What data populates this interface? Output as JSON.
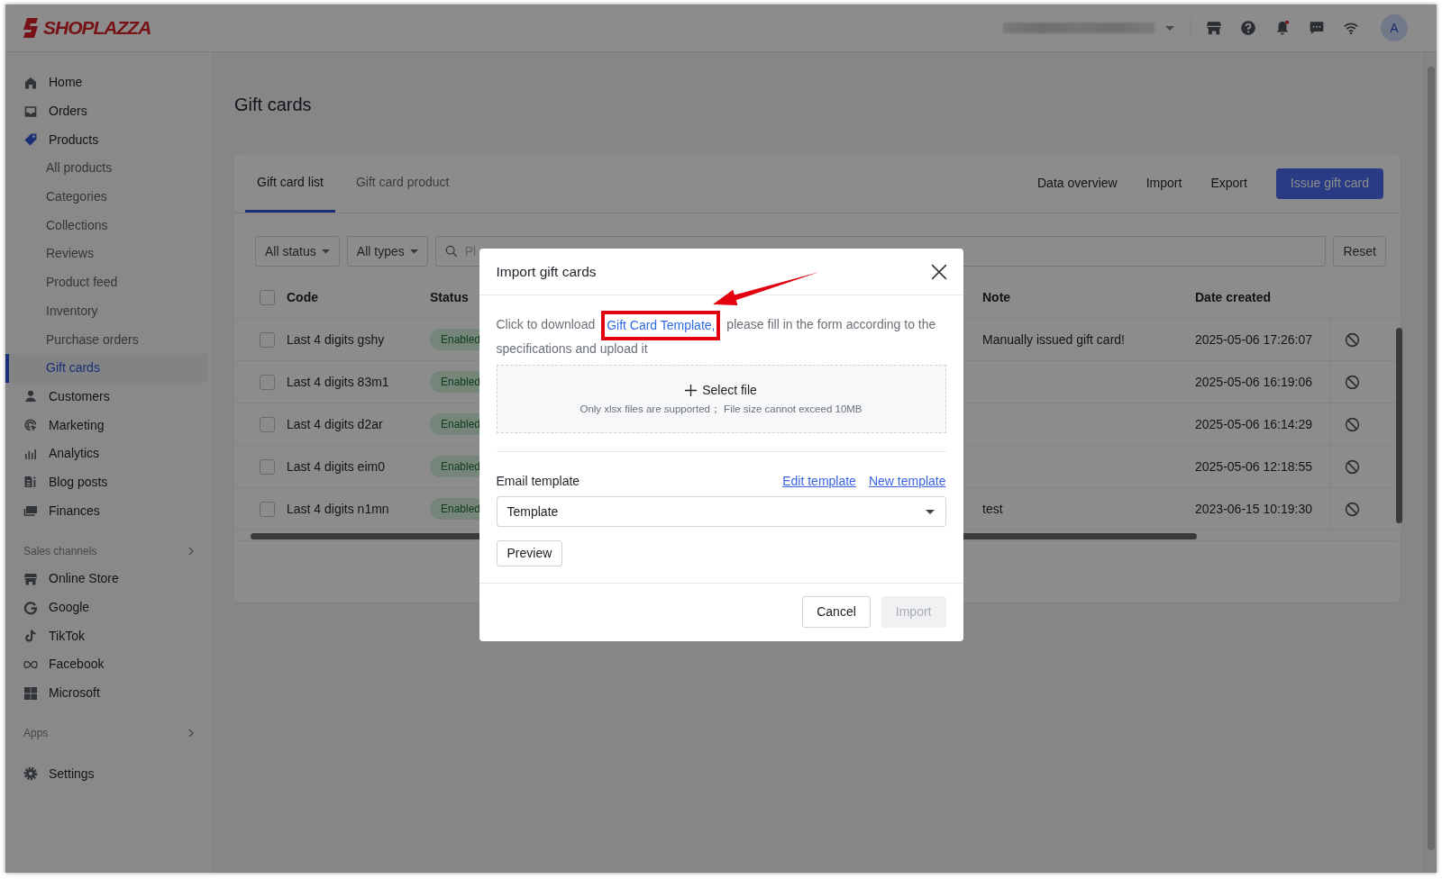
{
  "header": {
    "logo": "SHOPLAZZA",
    "avatar": "A",
    "notification": true
  },
  "sidebar": {
    "items": [
      {
        "label": "Home",
        "selected": false
      },
      {
        "label": "Orders",
        "selected": false
      },
      {
        "label": "Products",
        "selected": false,
        "expanded": true,
        "children": [
          {
            "label": "All products",
            "selected": false
          },
          {
            "label": "Categories",
            "selected": false
          },
          {
            "label": "Collections",
            "selected": false
          },
          {
            "label": "Reviews",
            "selected": false
          },
          {
            "label": "Product feed",
            "selected": false
          },
          {
            "label": "Inventory",
            "selected": false
          },
          {
            "label": "Purchase orders",
            "selected": false
          },
          {
            "label": "Gift cards",
            "selected": true
          }
        ]
      },
      {
        "label": "Customers",
        "selected": false
      },
      {
        "label": "Marketing",
        "selected": false
      },
      {
        "label": "Analytics",
        "selected": false
      },
      {
        "label": "Blog posts",
        "selected": false
      },
      {
        "label": "Finances",
        "selected": false
      }
    ],
    "sections": [
      {
        "title": "Sales channels",
        "items": [
          {
            "label": "Online Store",
            "selected": false
          },
          {
            "label": "Google",
            "selected": false
          },
          {
            "label": "TikTok",
            "selected": false
          },
          {
            "label": "Facebook",
            "selected": false
          },
          {
            "label": "Microsoft",
            "selected": false
          }
        ]
      },
      {
        "title": "Apps"
      }
    ],
    "settings": {
      "label": "Settings",
      "selected": false
    }
  },
  "page": {
    "title": "Gift cards"
  },
  "tabs": [
    {
      "label": "Gift card list",
      "selected": true
    },
    {
      "label": "Gift card product",
      "selected": false
    }
  ],
  "actions": [
    "Data overview",
    "Import",
    "Export"
  ],
  "primary_action": "Issue gift card",
  "filters": [
    "All status",
    "All types"
  ],
  "search": {
    "placeholder": "Pl"
  },
  "reset": "Reset",
  "table": {
    "all_checked": false,
    "columns": [
      "Code",
      "Status",
      "Note",
      "Date created"
    ],
    "rows": [
      {
        "code": "Last 4 digits gshy",
        "status": "Enabled",
        "note": "Manually issued gift card!",
        "date": "2025-05-06 17:26:07",
        "checked": false
      },
      {
        "code": "Last 4 digits 83m1",
        "status": "Enabled",
        "date": "2025-05-06 16:19:06",
        "checked": false
      },
      {
        "code": "Last 4 digits d2ar",
        "status": "Enabled",
        "date": "2025-05-06 16:14:29",
        "checked": false
      },
      {
        "code": "Last 4 digits eim0",
        "status": "Enabled",
        "date": "2025-05-06 12:18:55",
        "checked": false
      },
      {
        "code": "Last 4 digits n1mn",
        "status": "Enabled",
        "note": "test",
        "date": "2023-06-15 10:19:30",
        "checked": false
      }
    ]
  },
  "modal": {
    "title": "Import gift cards",
    "instruction": {
      "before": "Click to download ",
      "link": "Gift Card Template,",
      "after": " please fill in the form according to the specifications and upload it"
    },
    "upload": {
      "label": "Select file",
      "hint": "Only xlsx files are supported； File size cannot exceed 10MB"
    },
    "email": {
      "label": "Email template",
      "links": [
        "Edit template",
        "New template"
      ],
      "value": "Template"
    },
    "preview": "Preview",
    "buttons": [
      {
        "label": "Cancel",
        "disabled": false
      },
      {
        "label": "Import",
        "disabled": true
      }
    ]
  }
}
